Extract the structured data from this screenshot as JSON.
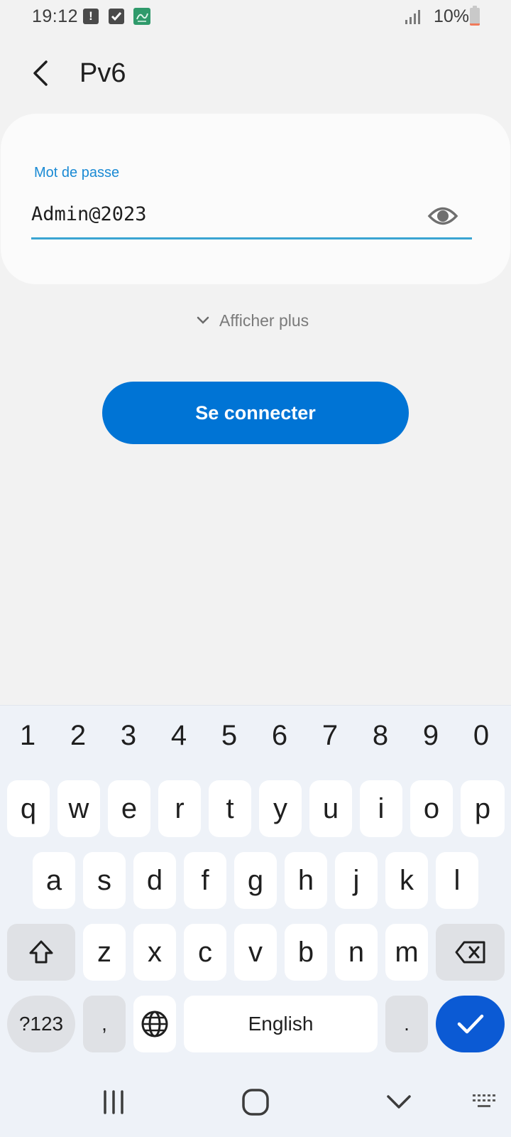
{
  "status_bar": {
    "time": "19:12",
    "battery_text": "10%",
    "battery_level": 0.1,
    "icons": [
      "alert-icon",
      "checkbox-icon",
      "app-notification-icon",
      "signal-icon",
      "battery-icon"
    ]
  },
  "header": {
    "title": "Pv6",
    "back_icon": "chevron-left-icon"
  },
  "password_field": {
    "label": "Mot de passe",
    "value": "Admin@2023",
    "toggle_icon": "eye-icon"
  },
  "show_more": {
    "label": "Afficher plus",
    "icon": "chevron-down-icon"
  },
  "connect_button": {
    "label": "Se connecter"
  },
  "keyboard": {
    "number_row": [
      "1",
      "2",
      "3",
      "4",
      "5",
      "6",
      "7",
      "8",
      "9",
      "0"
    ],
    "row1": [
      "q",
      "w",
      "e",
      "r",
      "t",
      "y",
      "u",
      "i",
      "o",
      "p"
    ],
    "row2": [
      "a",
      "s",
      "d",
      "f",
      "g",
      "h",
      "j",
      "k",
      "l"
    ],
    "row3": [
      "z",
      "x",
      "c",
      "v",
      "b",
      "n",
      "m"
    ],
    "symbols_key": "?123",
    "comma_key": ",",
    "space_key": "English",
    "period_key": ".",
    "shift_icon": "shift-icon",
    "backspace_icon": "backspace-icon",
    "language_icon": "globe-icon",
    "enter_icon": "checkmark-icon"
  },
  "colors": {
    "accent": "#0074d5",
    "field_label": "#1a8ad4",
    "underline": "#3aa4d2",
    "enter_key": "#0b5ad4",
    "background": "#f2f2f2"
  }
}
